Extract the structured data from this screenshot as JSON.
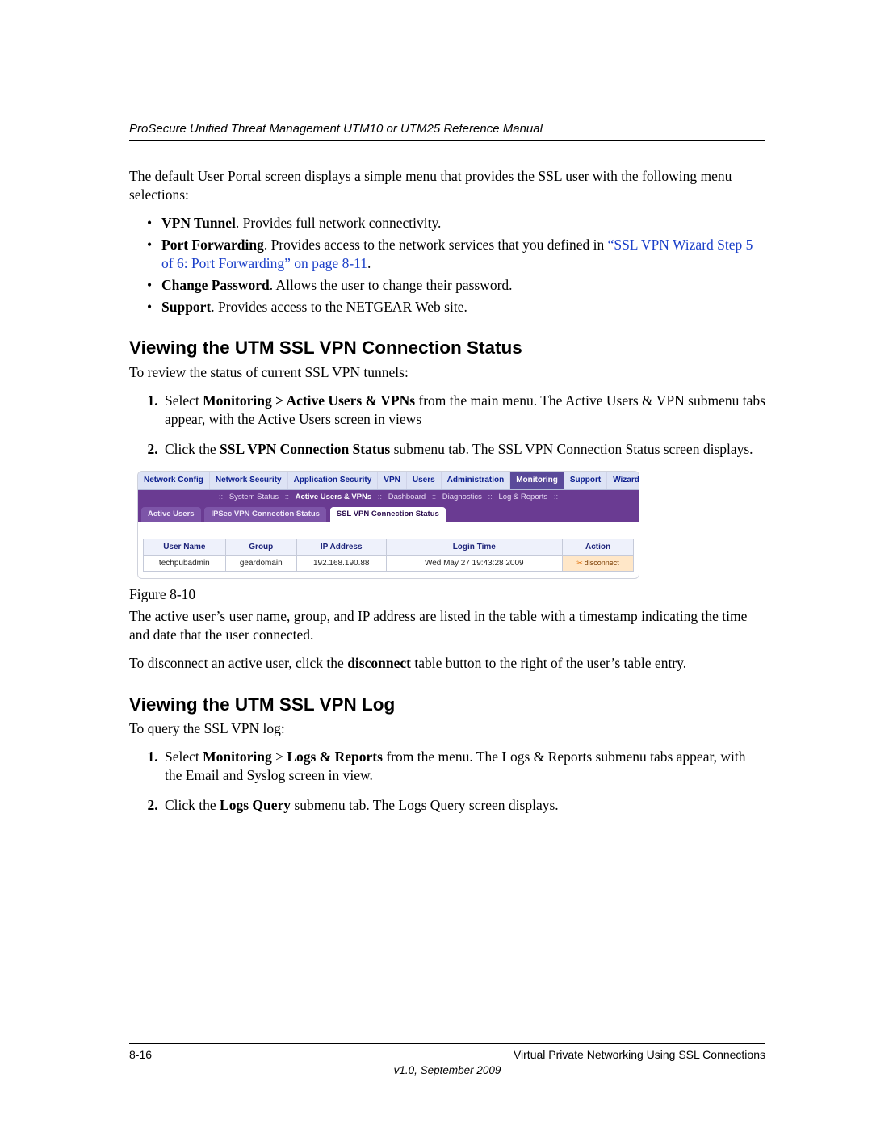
{
  "header": "ProSecure Unified Threat Management UTM10 or UTM25 Reference Manual",
  "intro": "The default User Portal screen displays a simple menu that provides the SSL user with the following menu selections:",
  "menu": {
    "items": [
      {
        "label": "VPN Tunnel",
        "desc": ". Provides full network connectivity."
      },
      {
        "label": "Port Forwarding",
        "desc": ". Provides access to the network services that you defined in ",
        "link": "“SSL VPN Wizard Step 5 of 6: Port Forwarding” on page 8-11",
        "tail": "."
      },
      {
        "label": "Change Password",
        "desc": ". Allows the user to change their password."
      },
      {
        "label": "Support",
        "desc": ". Provides access to the NETGEAR Web site."
      }
    ]
  },
  "section1": {
    "title": "Viewing the UTM SSL VPN Connection Status",
    "lead": "To review the status of current SSL VPN tunnels:",
    "steps": [
      {
        "pre": "Select ",
        "b": "Monitoring > Active Users & VPNs",
        "post": " from the main menu. The Active Users & VPN submenu tabs appear, with the Active Users screen in views"
      },
      {
        "pre": "Click the ",
        "b": "SSL VPN Connection Status",
        "post": " submenu tab. The SSL VPN Connection Status screen displays."
      }
    ],
    "caption": "Figure 8-10",
    "post1": {
      "t": "The active user’s user name, group, and IP address are listed in the table with a timestamp indicating the time and date that the user connected."
    },
    "post2": {
      "pre": "To disconnect an active user, click the ",
      "b": "disconnect",
      "post": " table button to the right of the user’s table entry."
    }
  },
  "figure": {
    "topnav": [
      "Network Config",
      "Network Security",
      "Application Security",
      "VPN",
      "Users",
      "Administration",
      "Monitoring",
      "Support",
      "Wizards"
    ],
    "topnav_selected": "Monitoring",
    "subnav": [
      "System Status",
      "Active Users & VPNs",
      "Dashboard",
      "Diagnostics",
      "Log & Reports"
    ],
    "tabs": [
      "Active Users",
      "IPSec VPN Connection Status",
      "SSL VPN Connection Status"
    ],
    "tab_active": "SSL VPN Connection Status",
    "columns": [
      "User Name",
      "Group",
      "IP Address",
      "Login Time",
      "Action"
    ],
    "row": {
      "user": "techpubadmin",
      "group": "geardomain",
      "ip": "192.168.190.88",
      "time": "Wed May 27 19:43:28 2009",
      "action": "disconnect"
    }
  },
  "section2": {
    "title": "Viewing the UTM SSL VPN Log",
    "lead": "To query the SSL VPN log:",
    "steps": [
      {
        "pre": "Select ",
        "b1": "Monitoring",
        "mid": " > ",
        "b2": "Logs & Reports",
        "post": " from the menu. The Logs & Reports submenu tabs appear, with the Email and Syslog screen in view."
      },
      {
        "pre": "Click the ",
        "b1": "Logs Query",
        "post": " submenu tab. The Logs Query screen displays."
      }
    ]
  },
  "footer": {
    "page": "8-16",
    "chapter": "Virtual Private Networking Using SSL Connections",
    "version": "v1.0, September 2009"
  }
}
